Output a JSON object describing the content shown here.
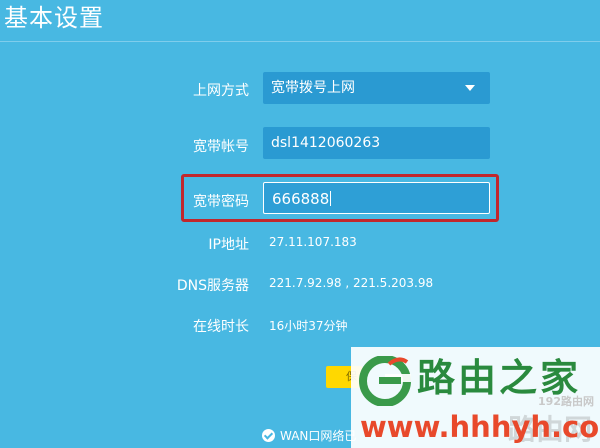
{
  "page": {
    "title": "基本设置"
  },
  "form": {
    "connection_type": {
      "label": "上网方式",
      "value": "宽带拨号上网"
    },
    "account": {
      "label": "宽带帐号",
      "value": "dsl1412060263"
    },
    "password": {
      "label": "宽带密码",
      "value": "666888"
    }
  },
  "info": {
    "ip": {
      "label": "IP地址",
      "value": "27.11.107.183"
    },
    "dns": {
      "label": "DNS服务器",
      "value": "221.7.92.98 , 221.5.203.98"
    },
    "uptime": {
      "label": "在线时长",
      "value": "16小时37分钟"
    }
  },
  "actions": {
    "save_label": "保"
  },
  "status": {
    "text": "WAN口网络已"
  },
  "watermark": {
    "brand": "路由之家",
    "url": "www.hhhyh.com",
    "faint_top": "192路由网",
    "faint_big": "路由网"
  },
  "colors": {
    "background": "#48b8e2",
    "field": "#2a9ad2",
    "highlight": "#c1272d",
    "save_button": "#ffd800",
    "brand_green": "#2a8a3e",
    "url_red": "#e8492b"
  }
}
